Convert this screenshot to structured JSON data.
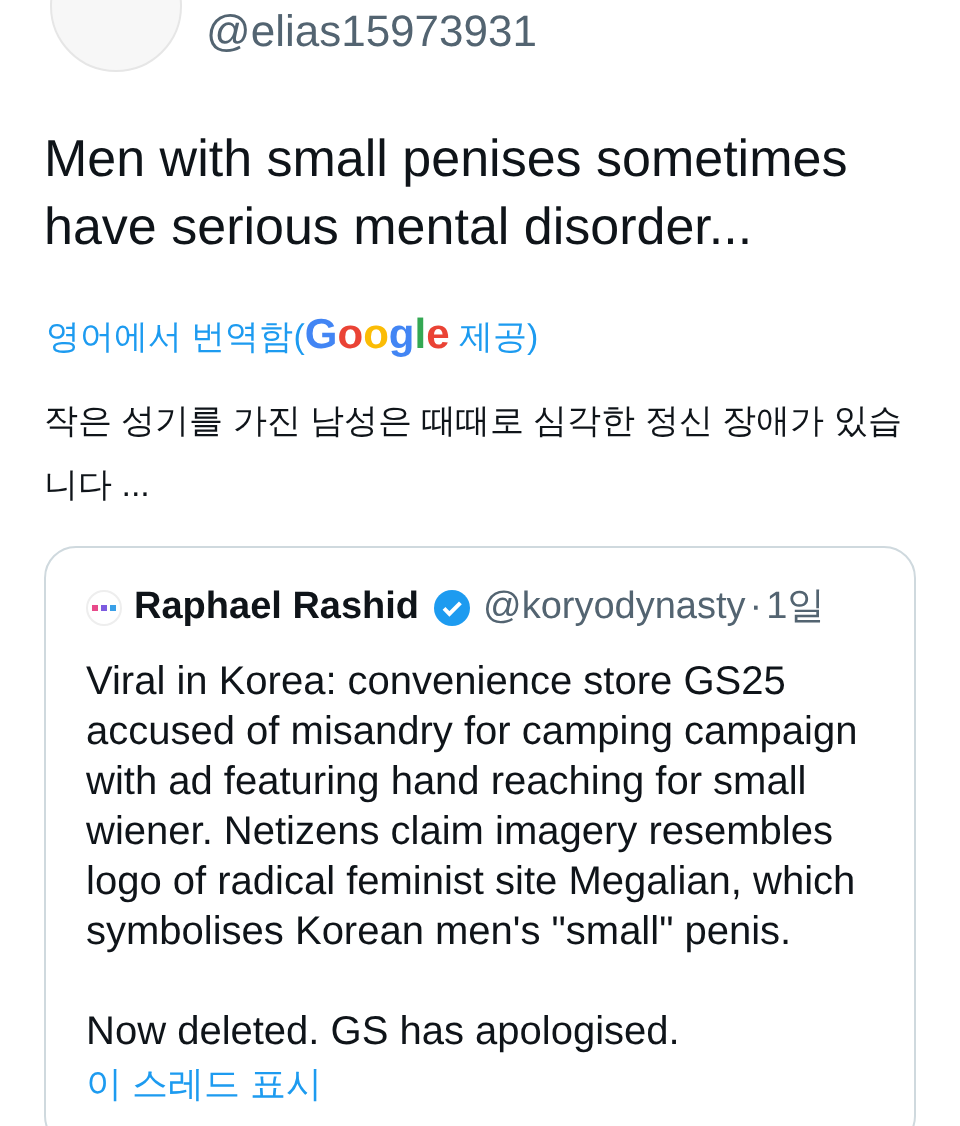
{
  "author": {
    "handle": "@elias15973931"
  },
  "tweet_text": "Men with small penises sometimes have serious mental disorder...",
  "translation": {
    "prefix": "영어에서 번역함(",
    "provider": "Google",
    "suffix": "제공)",
    "text": "작은 성기를 가진 남성은 때때로 심각한 정신 장애가 있습니다 ..."
  },
  "quoted_tweet": {
    "name": "Raphael Rashid",
    "verified": true,
    "handle": "@koryodynasty",
    "separator": "·",
    "time": "1일",
    "paragraphs": [
      "Viral in Korea: convenience store GS25 accused of misandry for camping campaign with ad featuring hand reaching for small wiener. Netizens claim imagery resembles logo of radical feminist site Megalian, which symbolises Korean men's \"small\" penis.",
      "Now deleted. GS has apologised."
    ],
    "thread_link": "이 스레드 표시"
  }
}
